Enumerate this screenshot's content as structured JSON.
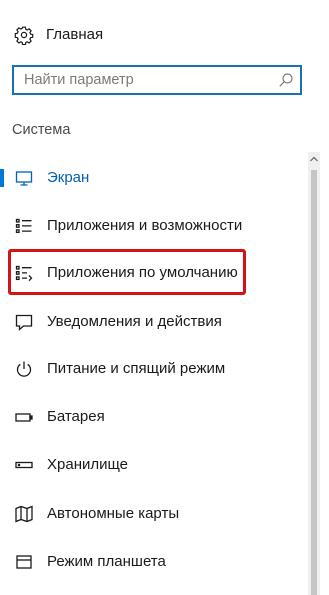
{
  "home": {
    "label": "Главная",
    "icon": "gear-icon"
  },
  "search": {
    "placeholder": "Найти параметр",
    "value": "",
    "icon": "search-icon"
  },
  "section": {
    "title": "Система"
  },
  "nav": {
    "items": [
      {
        "label": "Экран",
        "icon": "monitor-icon",
        "active": true
      },
      {
        "label": "Приложения и возможности",
        "icon": "apps-list-icon",
        "active": false
      },
      {
        "label": "Приложения по умолчанию",
        "icon": "default-apps-icon",
        "active": false,
        "highlighted": true
      },
      {
        "label": "Уведомления и действия",
        "icon": "notification-icon",
        "active": false
      },
      {
        "label": "Питание и спящий режим",
        "icon": "power-icon",
        "active": false
      },
      {
        "label": "Батарея",
        "icon": "battery-icon",
        "active": false
      },
      {
        "label": "Хранилище",
        "icon": "storage-icon",
        "active": false
      },
      {
        "label": "Автономные карты",
        "icon": "map-icon",
        "active": false
      },
      {
        "label": "Режим планшета",
        "icon": "tablet-icon",
        "active": false
      }
    ]
  },
  "colors": {
    "accent": "#0078d7",
    "highlight": "#d21414",
    "search_border": "#1a6fb5"
  }
}
